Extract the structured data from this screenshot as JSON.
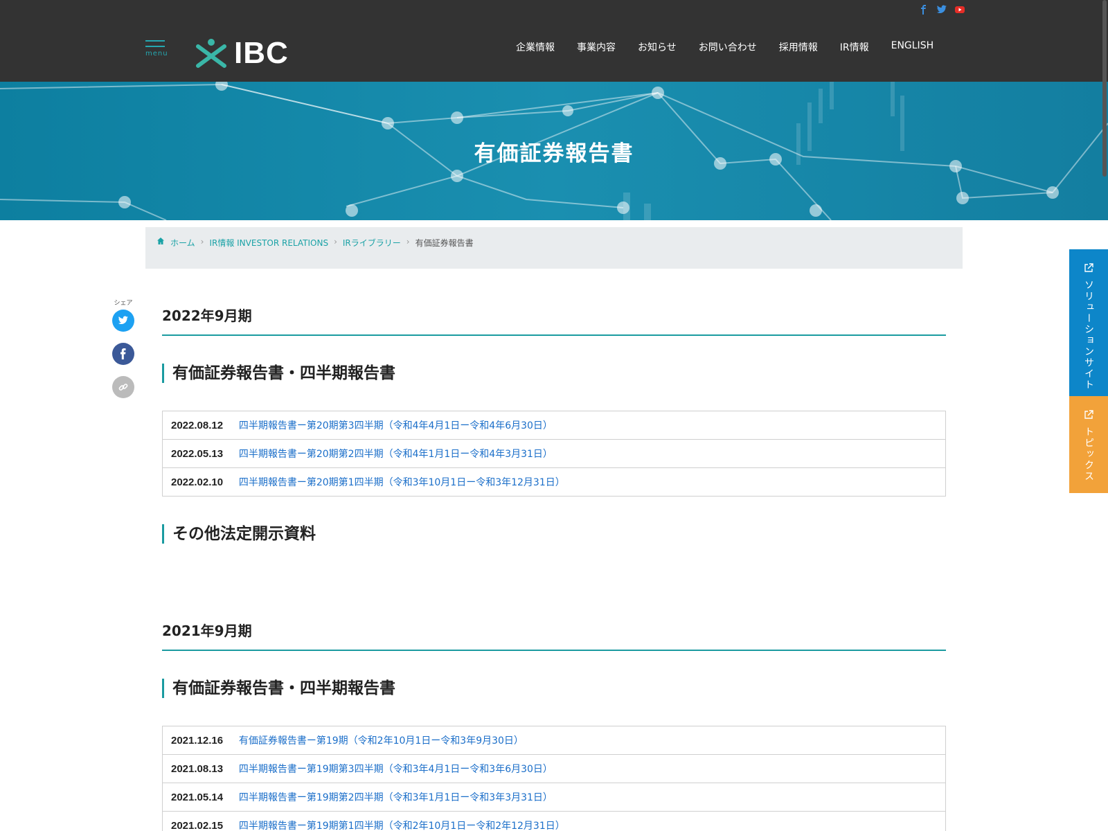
{
  "header": {
    "logo_text": "IBC",
    "menu_label": "menu",
    "social": [
      "facebook-icon",
      "twitter-icon",
      "youtube-icon"
    ],
    "nav": [
      "企業情報",
      "事業内容",
      "お知らせ",
      "お問い合わせ",
      "採用情報",
      "IR情報",
      "ENGLISH"
    ]
  },
  "hero": {
    "title": "有価証券報告書"
  },
  "breadcrumb": {
    "home": "ホーム",
    "items": [
      "IR情報 INVESTOR RELATIONS",
      "IRライブラリー"
    ],
    "current": "有価証券報告書"
  },
  "share": {
    "label": "シェア"
  },
  "sections": [
    {
      "fiscal_year": "2022年9月期",
      "subsections": [
        {
          "title": "有価証券報告書・四半期報告書",
          "rows": [
            {
              "date": "2022.08.12",
              "title": "四半期報告書ー第20期第3四半期（令和4年4月1日ー令和4年6月30日）"
            },
            {
              "date": "2022.05.13",
              "title": "四半期報告書ー第20期第2四半期（令和4年1月1日ー令和4年3月31日）"
            },
            {
              "date": "2022.02.10",
              "title": "四半期報告書ー第20期第1四半期（令和3年10月1日ー令和3年12月31日）"
            }
          ]
        },
        {
          "title": "その他法定開示資料",
          "rows": []
        }
      ]
    },
    {
      "fiscal_year": "2021年9月期",
      "subsections": [
        {
          "title": "有価証券報告書・四半期報告書",
          "rows": [
            {
              "date": "2021.12.16",
              "title": "有価証券報告書ー第19期（令和2年10月1日ー令和3年9月30日）"
            },
            {
              "date": "2021.08.13",
              "title": "四半期報告書ー第19期第3四半期（令和3年4月1日ー令和3年6月30日）"
            },
            {
              "date": "2021.05.14",
              "title": "四半期報告書ー第19期第2四半期（令和3年1月1日ー令和3年3月31日）"
            },
            {
              "date": "2021.02.15",
              "title": "四半期報告書ー第19期第1四半期（令和2年10月1日ー令和2年12月31日）"
            }
          ]
        }
      ]
    }
  ],
  "side_tabs": {
    "solution": "ソリューションサイト",
    "topics": "トピックス"
  },
  "colors": {
    "header_bg": "#333333",
    "accent_teal": "#1a9ba0",
    "link_blue": "#1a6ec9",
    "tab_blue": "#0d86c9",
    "tab_orange": "#f2a23a"
  }
}
